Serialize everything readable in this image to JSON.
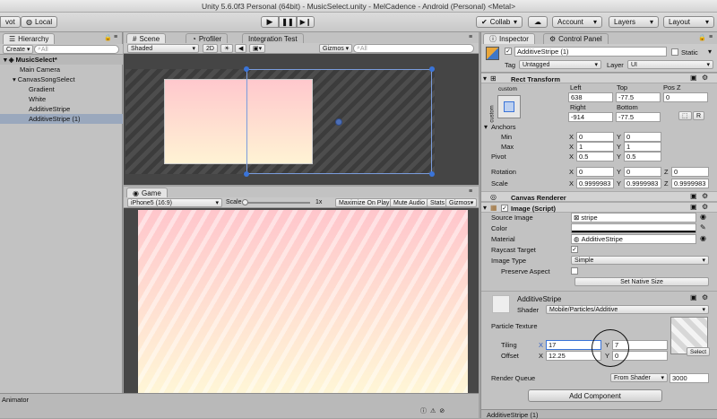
{
  "window": {
    "title": "Unity 5.6.0f3 Personal (64bit) - MusicSelect.unity - MelCadence - Android (Personal) <Metal>"
  },
  "toolbar": {
    "pivot": "vot",
    "local": "Local",
    "collab": "Collab",
    "account": "Account",
    "layers": "Layers",
    "layout": "Layout"
  },
  "hierarchy": {
    "tab": "Hierarchy",
    "create": "Create",
    "search_placeholder": "All",
    "items": [
      {
        "label": "MusicSelect*"
      },
      {
        "label": "Main Camera"
      },
      {
        "label": "CanvasSongSelect"
      },
      {
        "label": "Gradient"
      },
      {
        "label": "White"
      },
      {
        "label": "AdditiveStripe"
      },
      {
        "label": "AdditiveStripe (1)"
      }
    ]
  },
  "scene": {
    "tab": "Scene",
    "profiler_tab": "Profiler",
    "integration_tab": "Integration Test",
    "shading": "Shaded",
    "mode_2d": "2D",
    "gizmos": "Gizmos",
    "search_placeholder": "All"
  },
  "game": {
    "tab": "Game",
    "resolution": "iPhone5 (16:9)",
    "scale_label": "Scale",
    "scale_value": "1x",
    "maximize": "Maximize On Play",
    "mute": "Mute Audio",
    "stats": "Stats",
    "gizmos": "Gizmos"
  },
  "animator": {
    "tab": "Animator"
  },
  "inspector": {
    "tab": "Inspector",
    "control_tab": "Control Panel",
    "object_name": "AdditiveStripe (1)",
    "static_label": "Static",
    "tag_label": "Tag",
    "tag_value": "Untagged",
    "layer_label": "Layer",
    "layer_value": "UI",
    "rect": {
      "title": "Rect Transform",
      "anchor_preset": "custom",
      "side": "custom",
      "left_label": "Left",
      "top_label": "Top",
      "posz_label": "Pos Z",
      "left": "638",
      "top": "-77.5",
      "posz": "0",
      "right_label": "Right",
      "bottom_label": "Bottom",
      "right": "-914",
      "bottom": "-77.5",
      "r_btn": "R",
      "anchors_label": "Anchors",
      "min_label": "Min",
      "max_label": "Max",
      "pivot_label": "Pivot",
      "min_x": "0",
      "min_y": "0",
      "max_x": "1",
      "max_y": "1",
      "pivot_x": "0.5",
      "pivot_y": "0.5",
      "rotation_label": "Rotation",
      "rot_x": "0",
      "rot_y": "0",
      "rot_z": "0",
      "scale_label": "Scale",
      "scale_x": "0.9999983",
      "scale_y": "0.9999983",
      "scale_z": "0.9999983"
    },
    "canvas_renderer": {
      "title": "Canvas Renderer"
    },
    "image": {
      "title": "Image (Script)",
      "source_label": "Source Image",
      "source_value": "stripe",
      "color_label": "Color",
      "material_label": "Material",
      "material_value": "AdditiveStripe",
      "raycast_label": "Raycast Target",
      "image_type_label": "Image Type",
      "image_type_value": "Simple",
      "preserve_label": "Preserve Aspect",
      "native_btn": "Set Native Size"
    },
    "material": {
      "name": "AdditiveStripe",
      "shader_label": "Shader",
      "shader_value": "Mobile/Particles/Additive",
      "texture_label": "Particle Texture",
      "tiling_label": "Tiling",
      "tiling_x": "17",
      "tiling_y": "7",
      "offset_label": "Offset",
      "offset_x": "12.25",
      "offset_y": "0",
      "select_btn": "Select",
      "render_queue_label": "Render Queue",
      "render_queue_mode": "From Shader",
      "render_queue_value": "3000"
    },
    "add_component": "Add Component",
    "footer_tab": "AdditiveStripe (1)"
  },
  "colors": {
    "accent": "#3a74d8",
    "selection": "#9aa8bd",
    "stripe_a": "#ffc6cc",
    "stripe_b": "#fff6d6"
  }
}
